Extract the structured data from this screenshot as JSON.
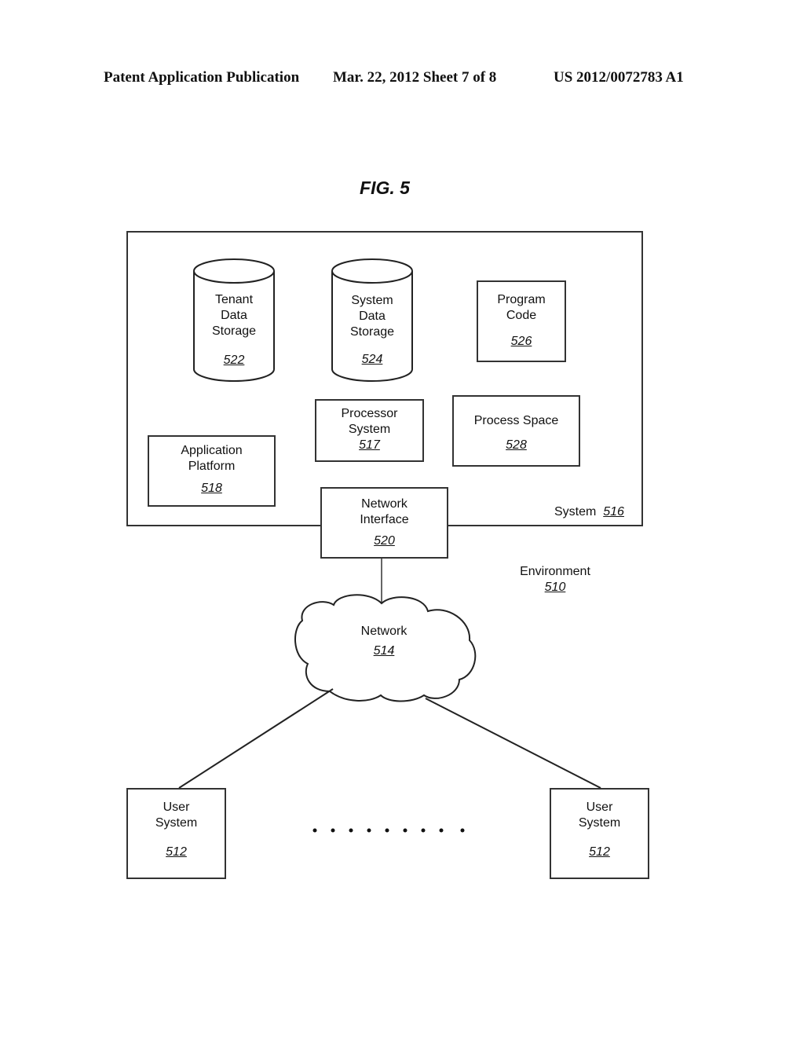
{
  "header": {
    "left": "Patent Application Publication",
    "center": "Mar. 22, 2012  Sheet 7 of 8",
    "right": "US 2012/0072783 A1"
  },
  "figure": {
    "title": "FIG. 5",
    "system": {
      "label": "System",
      "ref": "516"
    },
    "environment": {
      "label": "Environment",
      "ref": "510"
    },
    "tenant_storage": {
      "lines": [
        "Tenant",
        "Data",
        "Storage"
      ],
      "ref": "522"
    },
    "system_storage": {
      "lines": [
        "System",
        "Data",
        "Storage"
      ],
      "ref": "524"
    },
    "program_code": {
      "lines": [
        "Program",
        "Code"
      ],
      "ref": "526"
    },
    "processor_system": {
      "lines": [
        "Processor",
        "System"
      ],
      "ref": "517"
    },
    "process_space": {
      "lines": [
        "Process Space"
      ],
      "ref": "528"
    },
    "application_platform": {
      "lines": [
        "Application",
        "Platform"
      ],
      "ref": "518"
    },
    "network_interface": {
      "lines": [
        "Network",
        "Interface"
      ],
      "ref": "520"
    },
    "network": {
      "lines": [
        "Network"
      ],
      "ref": "514"
    },
    "user_systems": [
      {
        "lines": [
          "User",
          "System"
        ],
        "ref": "512"
      },
      {
        "lines": [
          "User",
          "System"
        ],
        "ref": "512"
      }
    ],
    "ellipsis_dots": 9
  }
}
